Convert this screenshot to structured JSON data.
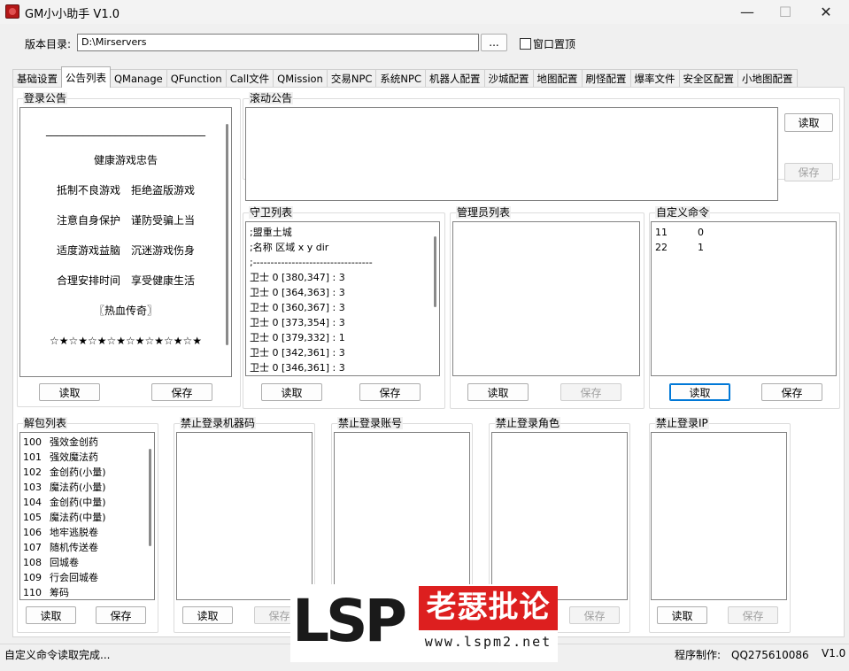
{
  "window": {
    "title": "GM小小助手 V1.0",
    "minimize": "—",
    "maximize": "☐",
    "close": "✕"
  },
  "path": {
    "label": "版本目录:",
    "value": "D:\\Mirservers",
    "browse": "...",
    "topmost_label": "窗口置顶"
  },
  "tabs": [
    "基础设置",
    "公告列表",
    "QManage",
    "QFunction",
    "Call文件",
    "QMission",
    "交易NPC",
    "系统NPC",
    "机器人配置",
    "沙城配置",
    "地图配置",
    "刷怪配置",
    "爆率文件",
    "安全区配置",
    "小地图配置"
  ],
  "active_tab": "公告列表",
  "login_notice": {
    "title": "登录公告",
    "lines": [
      "______________________________",
      "健康游戏忠告",
      "抵制不良游戏　拒绝盗版游戏",
      "注意自身保护　谨防受骗上当",
      "适度游戏益脑　沉迷游戏伤身",
      "合理安排时间　享受健康生活",
      "〖热血传奇〗",
      "☆★☆★☆★☆★☆★☆★☆★☆★",
      "______________________________"
    ],
    "read": "读取",
    "save": "保存"
  },
  "scroll_notice": {
    "title": "滚动公告",
    "read": "读取",
    "save": "保存"
  },
  "guard_list": {
    "title": "守卫列表",
    "lines": [
      ";盟重土城",
      ";名称 区域 x y dir",
      ";----------------------------------",
      "卫士 0 [380,347] : 3",
      "卫士 0 [364,363] : 3",
      "卫士 0 [360,367] : 3",
      "卫士 0 [373,354] : 3",
      "卫士 0 [379,332] : 1",
      "卫士 0 [342,361] : 3",
      "卫士 0 [346,361] : 3"
    ],
    "read": "读取",
    "save": "保存"
  },
  "admin_list": {
    "title": "管理员列表",
    "read": "读取",
    "save": "保存"
  },
  "custom_cmd": {
    "title": "自定义命令",
    "rows": [
      [
        "11",
        "0"
      ],
      [
        "22",
        "1"
      ]
    ],
    "read": "读取",
    "save": "保存"
  },
  "unpack_list": {
    "title": "解包列表",
    "rows": [
      [
        "100",
        "强效金创药"
      ],
      [
        "101",
        "强效魔法药"
      ],
      [
        "102",
        "金创药(小量)"
      ],
      [
        "103",
        "魔法药(小量)"
      ],
      [
        "104",
        "金创药(中量)"
      ],
      [
        "105",
        "魔法药(中量)"
      ],
      [
        "106",
        "地牢逃脱卷"
      ],
      [
        "107",
        "随机传送卷"
      ],
      [
        "108",
        "回城卷"
      ],
      [
        "109",
        "行会回城卷"
      ],
      [
        "110",
        "筹码"
      ]
    ],
    "read": "读取",
    "save": "保存"
  },
  "ban_machine": {
    "title": "禁止登录机器码",
    "read": "读取",
    "save": "保存"
  },
  "ban_account": {
    "title": "禁止登录账号"
  },
  "ban_role": {
    "title": "禁止登录角色",
    "save": "保存"
  },
  "ban_ip": {
    "title": "禁止登录IP",
    "read": "读取",
    "save": "保存"
  },
  "status": {
    "message": "自定义命令读取完成...",
    "author": "程序制作:　QQ275610086",
    "version": "V1.0"
  },
  "watermark": {
    "logo": "LSP",
    "site_name": "老瑟批论坛",
    "url": "www.lspm2.net"
  }
}
